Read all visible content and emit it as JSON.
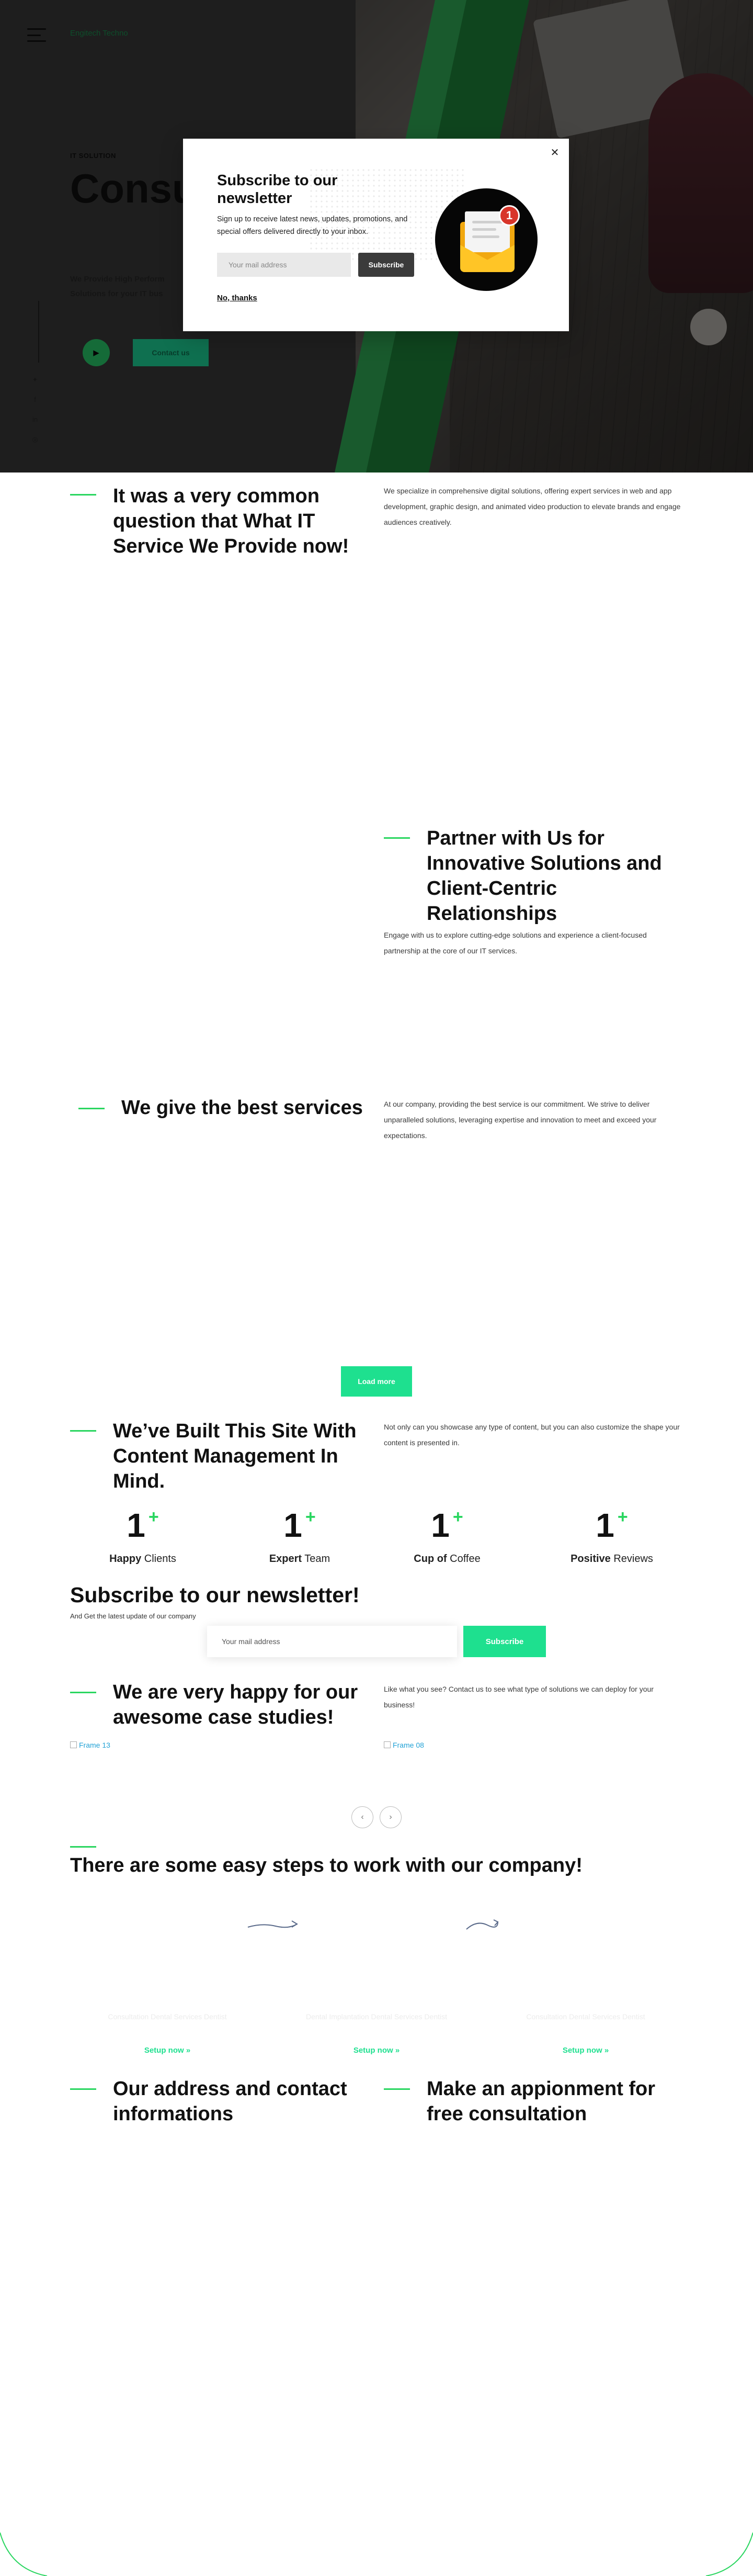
{
  "header": {
    "logo_alt": "Engitech Techno",
    "menu_icon": "hamburger-icon"
  },
  "hero": {
    "eyebrow": "IT SOLUTION",
    "title": "Consult find s",
    "subtitle": "We Provide High Perform Solutions for your IT bus",
    "play_icon": "play-icon",
    "cta_label": "Contact us",
    "social_icons": [
      "twitter-icon",
      "facebook-icon",
      "linkedin-icon",
      "instagram-icon",
      "youtube-icon"
    ],
    "accent_color": "#2ad660",
    "accent_dark": "#1f8a3d"
  },
  "popup": {
    "title": "Subscribe to our newsletter",
    "text": "Sign up to receive latest news, updates, promotions, and special offers delivered directly to your inbox.",
    "input_placeholder": "Your mail address",
    "subscribe_label": "Subscribe",
    "dismiss_label": "No, thanks",
    "close_icon": "close-icon",
    "notification_count": "1"
  },
  "section_it": {
    "title": "It was a very common question that What IT Service We Provide now!",
    "text": "We specialize in comprehensive digital solutions, offering expert services in web and app development, graphic design, and animated video production to elevate brands and engage audiences creatively."
  },
  "section_partner": {
    "title": "Partner with Us for Innovative Solutions and Client-Centric Relationships",
    "text": "Engage with us to explore cutting-edge solutions and experience a client-focused partnership at the core of our IT services."
  },
  "section_services": {
    "title": "We give the best services",
    "text": "At our company, providing the best service is our commitment. We strive to deliver unparalleled solutions, leveraging expertise and innovation to meet and exceed your expectations."
  },
  "load_more_label": "Load more",
  "section_cms": {
    "title": "We’ve Built This Site With Content Management In Mind.",
    "text": "Not only can you showcase any type of content, but you can also customize the shape your content is presented in."
  },
  "counters": [
    {
      "value": "1",
      "plus": "+",
      "bold": "Happy",
      "rest": " Clients"
    },
    {
      "value": "1",
      "plus": "+",
      "bold": "Expert",
      "rest": " Team"
    },
    {
      "value": "1",
      "plus": "+",
      "bold": "Cup of",
      "rest": " Coffee"
    },
    {
      "value": "1",
      "plus": "+",
      "bold": "Positive",
      "rest": " Reviews"
    }
  ],
  "newsletter": {
    "title": "Subscribe to our newsletter!",
    "subtitle": "And Get the latest update of our company",
    "input_placeholder": "Your mail address",
    "button_label": "Subscribe"
  },
  "section_cases": {
    "title": "We are very happy for our awesome case studies!",
    "text": "Like what you see? Contact us to see what type of solutions we can deploy for your business!",
    "images": [
      "Frame 13",
      "Frame 08"
    ],
    "prev_icon": "chevron-left-icon",
    "next_icon": "chevron-right-icon"
  },
  "steps": {
    "title": "There are some easy steps to work with our company!",
    "items": [
      {
        "ghost": "Consultation Dental Services Dentist",
        "link": "Setup now »"
      },
      {
        "ghost": "Dental Implantation Dental Services Dentist",
        "link": "Setup now »"
      },
      {
        "ghost": "Consultation Dental Services Dentist",
        "link": "Setup now »"
      }
    ]
  },
  "section_address": {
    "title": "Our address and contact informations"
  },
  "section_appointment": {
    "title": "Make an appionment for free consultation"
  }
}
